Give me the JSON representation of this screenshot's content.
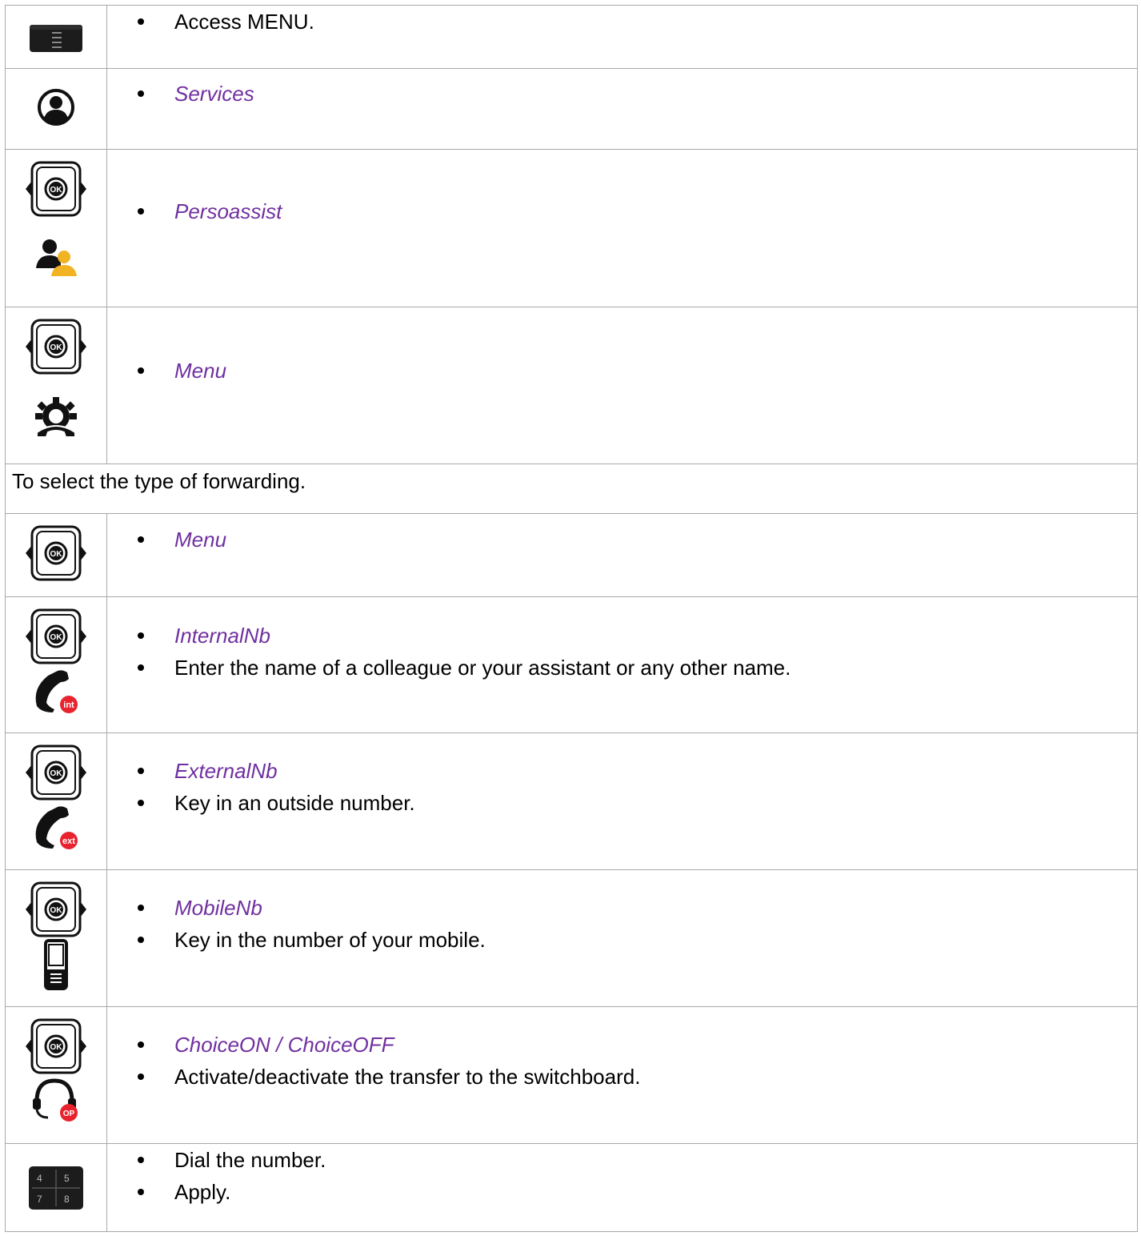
{
  "rows": [
    {
      "icons": [
        "menu-key-icon"
      ],
      "items": [
        {
          "text": "Access MENU.",
          "keyword": false
        }
      ]
    },
    {
      "icons": [
        "services-user-icon"
      ],
      "items": [
        {
          "text": "Services",
          "keyword": true
        }
      ]
    },
    {
      "icons": [
        "ok-navigator-icon",
        "persoassist-icon"
      ],
      "items": [
        {
          "text": "Persoassist",
          "keyword": true
        }
      ]
    },
    {
      "icons": [
        "ok-navigator-icon",
        "phone-settings-gear-icon"
      ],
      "items": [
        {
          "text": "Menu",
          "keyword": true
        }
      ]
    },
    {
      "note": "To select the type of forwarding."
    },
    {
      "icons": [
        "ok-navigator-icon"
      ],
      "items": [
        {
          "text": "Menu",
          "keyword": true
        }
      ]
    },
    {
      "icons": [
        "ok-navigator-icon",
        "handset-int-icon"
      ],
      "items": [
        {
          "text": "InternalNb",
          "keyword": true
        },
        {
          "text": "Enter the name of a colleague or your assistant or any other name.",
          "keyword": false
        }
      ]
    },
    {
      "icons": [
        "ok-navigator-icon",
        "handset-ext-icon"
      ],
      "items": [
        {
          "text": "ExternalNb",
          "keyword": true
        },
        {
          "text": "Key in an outside number.",
          "keyword": false
        }
      ]
    },
    {
      "icons": [
        "ok-navigator-icon",
        "mobile-phone-icon"
      ],
      "items": [
        {
          "text": "MobileNb",
          "keyword": true
        },
        {
          "text": "Key in the number of your mobile.",
          "keyword": false
        }
      ]
    },
    {
      "icons": [
        "ok-navigator-icon",
        "headset-op-icon"
      ],
      "items": [
        {
          "text": "ChoiceON / ChoiceOFF",
          "keyword": true
        },
        {
          "text": "Activate/deactivate the transfer to the switchboard.",
          "keyword": false
        }
      ]
    },
    {
      "icons": [
        "numeric-keypad-icon"
      ],
      "items": [
        {
          "text": "Dial the number.",
          "keyword": false
        },
        {
          "text": "Apply.",
          "keyword": false
        }
      ]
    }
  ],
  "badges": {
    "int": "int",
    "ext": "ext",
    "op": "OP"
  },
  "keypad": [
    "4",
    "5",
    "7",
    "8"
  ],
  "ok_label": "OK",
  "colors": {
    "keyword": "#7030a0",
    "badge": "#e8232e",
    "persoassist_accent": "#f0b323",
    "border": "#a8a8a8"
  }
}
